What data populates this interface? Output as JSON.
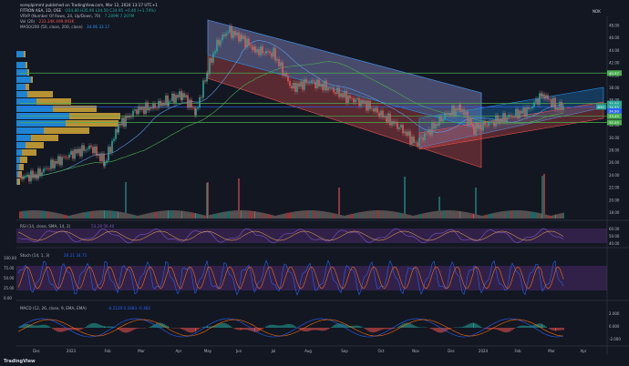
{
  "header": {
    "published_line": "soreplpimmt published on TradingView.com, Mar 12, 2024 13:17 UTC+1",
    "symbol_line": "FITRON ASA, 1D, OSE",
    "ohlc": "O34.80 H35.90 L34.50 C34.95 +0.40 (+1.79%)",
    "vrvp": "VRVP (Number Of Rows, 24, Up/Down, 70)",
    "vrvp_vals": "7.289M  7.207M",
    "vol": "Vol (20)",
    "vol_vals": "233.34K  499.093K",
    "ma": "MA50/200 (50, close, 200, close)",
    "ma_vals": "34.06  33.17",
    "currency": "NOK",
    "tv_logo": "TradingView"
  },
  "colors": {
    "background": "#131722",
    "up": "#26a69a",
    "down": "#ef5350",
    "volume_profile_up": "#2196f3",
    "volume_profile_down": "#d4a838",
    "green_line": "#4caf50",
    "indicator_band": "#4a2a6a",
    "rsi_line": "#7e57c2",
    "stoch_k": "#2962ff",
    "stoch_d": "#ff6d00"
  },
  "price_axis": {
    "labels": [
      "48.00",
      "46.00",
      "44.00",
      "42.00",
      "40.00",
      "38.00",
      "36.00",
      "34.00",
      "32.00",
      "30.00",
      "28.00",
      "26.00",
      "24.00",
      "22.00",
      "20.00",
      "18.00"
    ],
    "markers": [
      {
        "text": "40.37",
        "color": "#4caf50",
        "price": 40.37
      },
      {
        "text": "35.50",
        "color": "#26a69a",
        "price": 35.5
      },
      {
        "text": "34.95",
        "color": "#26a69a",
        "price": 34.95
      },
      {
        "text": "34.90",
        "color": "#2962ff",
        "price": 34.3
      },
      {
        "text": "33.45",
        "color": "#4caf50",
        "price": 33.45
      },
      {
        "text": "32.45",
        "color": "#4caf50",
        "price": 32.45
      }
    ],
    "price_tag": "835"
  },
  "rsi": {
    "label": "RSI (14, close, SMA, 14, 2)",
    "values": "53.28  56.40",
    "axis": [
      "60.00",
      "50.00",
      "40.00"
    ]
  },
  "stoch": {
    "label": "Stoch (14, 1, 3)",
    "values": "26.21  34.71",
    "axis": [
      "100.00",
      "75.00",
      "50.00",
      "25.00",
      "0.00"
    ]
  },
  "macd": {
    "label": "MACD (12, 26, close, 9, EMA, EMA)",
    "values": "-0.2129  0.1683  -0.362",
    "axis": [
      "2.000",
      "0.000",
      "-2.000"
    ]
  },
  "time_axis": [
    "Dec",
    "2023",
    "Feb",
    "Mar",
    "Apr",
    "May",
    "Jun",
    "Jul",
    "Aug",
    "Sep",
    "Oct",
    "Nov",
    "Dec",
    "2024",
    "Feb",
    "Mar",
    "Apr"
  ]
}
